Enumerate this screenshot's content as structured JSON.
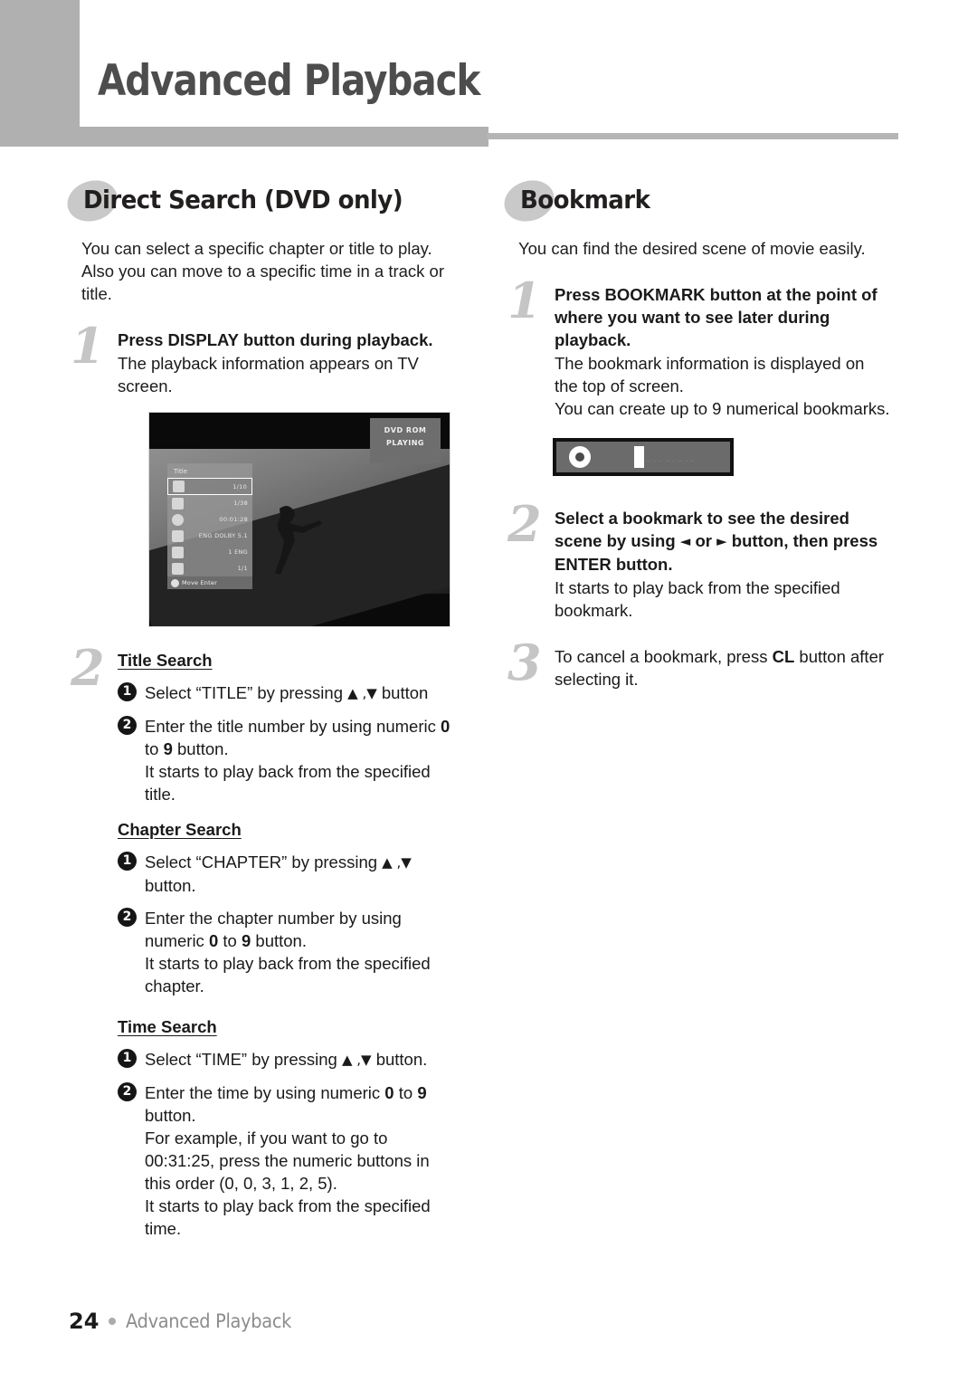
{
  "header": {
    "title": "Advanced Playback"
  },
  "footer": {
    "page_number": "24",
    "label": "Advanced Playback"
  },
  "left_column": {
    "heading": "Direct Search (DVD only)",
    "intro": "You can select a specific chapter or title to play. Also you can move to a specific time in a track or title.",
    "step1": {
      "number": "1",
      "title": "Press DISPLAY button during playback.",
      "body": "The playback information appears on TV screen."
    },
    "tv_screen": {
      "status_line1": "DVD ROM",
      "status_line2": "PLAYING",
      "osd_title": "Title",
      "osd_rows": [
        {
          "icon": "title-icon",
          "value": "1/10",
          "selected": true
        },
        {
          "icon": "chapter-icon",
          "value": "1/38",
          "selected": false
        },
        {
          "icon": "time-icon",
          "value": "00:01:28",
          "selected": false
        },
        {
          "icon": "audio-icon",
          "value": "ENG DOLBY 5.1",
          "selected": false
        },
        {
          "icon": "subtitle-icon",
          "value": "1 ENG",
          "selected": false
        },
        {
          "icon": "angle-icon",
          "value": "1/1",
          "selected": false
        }
      ],
      "osd_footer": "Move    Enter"
    },
    "step2": {
      "number": "2",
      "subsections": [
        {
          "title": "Title Search",
          "items": [
            {
              "mark": "1",
              "parts": [
                {
                  "text": "Select “TITLE” by pressing ",
                  "bold": false
                },
                {
                  "text": "▲ ,▼",
                  "bold": false,
                  "glyph": true
                },
                {
                  "text": " button",
                  "bold": false
                }
              ]
            },
            {
              "mark": "2",
              "parts": [
                {
                  "text": "Enter the title number by using numeric ",
                  "bold": false
                },
                {
                  "text": "0",
                  "bold": true
                },
                {
                  "text": " to ",
                  "bold": false
                },
                {
                  "text": "9",
                  "bold": true
                },
                {
                  "text": " button.",
                  "bold": false
                },
                {
                  "text": "<br>It starts to play back from the specified title.",
                  "bold": false,
                  "html": true
                }
              ]
            }
          ]
        },
        {
          "title": "Chapter Search",
          "items": [
            {
              "mark": "1",
              "parts": [
                {
                  "text": "Select “CHAPTER” by pressing ",
                  "bold": false
                },
                {
                  "text": "▲ ,▼",
                  "bold": false,
                  "glyph": true
                },
                {
                  "text": " button.",
                  "bold": false
                }
              ]
            },
            {
              "mark": "2",
              "parts": [
                {
                  "text": "Enter the chapter number by using numeric ",
                  "bold": false
                },
                {
                  "text": "0",
                  "bold": true
                },
                {
                  "text": " to ",
                  "bold": false
                },
                {
                  "text": "9",
                  "bold": true
                },
                {
                  "text": " button.",
                  "bold": false
                },
                {
                  "text": "<br>It starts to play back from the specified chapter.",
                  "bold": false,
                  "html": true
                }
              ]
            }
          ]
        },
        {
          "title": "Time Search",
          "items": [
            {
              "mark": "1",
              "parts": [
                {
                  "text": "Select “TIME” by pressing ",
                  "bold": false
                },
                {
                  "text": "▲ ,▼",
                  "bold": false,
                  "glyph": true
                },
                {
                  "text": " button.",
                  "bold": false
                }
              ]
            },
            {
              "mark": "2",
              "parts": [
                {
                  "text": "Enter the time by using numeric ",
                  "bold": false
                },
                {
                  "text": "0",
                  "bold": true
                },
                {
                  "text": " to ",
                  "bold": false
                },
                {
                  "text": "9",
                  "bold": true
                },
                {
                  "text": " button.",
                  "bold": false
                },
                {
                  "text": "<br>For example, if you want to go to 00:31:25, press the numeric buttons in this order (0, 0, 3, 1, 2, 5).<br>It starts to play back from the specified time.",
                  "bold": false,
                  "html": true
                }
              ]
            }
          ]
        }
      ]
    }
  },
  "right_column": {
    "heading": "Bookmark",
    "intro": "You can find the desired scene of movie easily.",
    "step1": {
      "number": "1",
      "title": "Press BOOKMARK button at the point of where you want to see later during playback.",
      "body": "The bookmark information is displayed on the top of screen.\nYou can create up to 9 numerical bookmarks."
    },
    "bookmark_figure": {
      "disc_icon": "disc-icon",
      "marker_icon": "bookmark-marker-icon",
      "ticks": "– – – – – – – –"
    },
    "step2": {
      "number": "2",
      "title_parts": [
        {
          "text": "Select a bookmark to see the desired scene by using ",
          "bold": true
        },
        {
          "text": "◄",
          "bold": true,
          "glyph": true
        },
        {
          "text": " or ",
          "bold": true
        },
        {
          "text": "►",
          "bold": true,
          "glyph": true
        },
        {
          "text": " button, then press ENTER button.",
          "bold": true
        }
      ],
      "body": "It starts to play back from the specified bookmark."
    },
    "step3": {
      "number": "3",
      "body_parts": [
        {
          "text": "To cancel a bookmark, press ",
          "bold": false
        },
        {
          "text": "CL",
          "bold": true
        },
        {
          "text": " button after selecting it.",
          "bold": false
        }
      ]
    }
  },
  "colors": {
    "header_gray": "#b0b0b0",
    "blob_gray": "#c9c9c9",
    "step_number_gray": "#c5c5c5",
    "footer_label_gray": "#8c8c8c",
    "text_black": "#1a1a1a"
  }
}
